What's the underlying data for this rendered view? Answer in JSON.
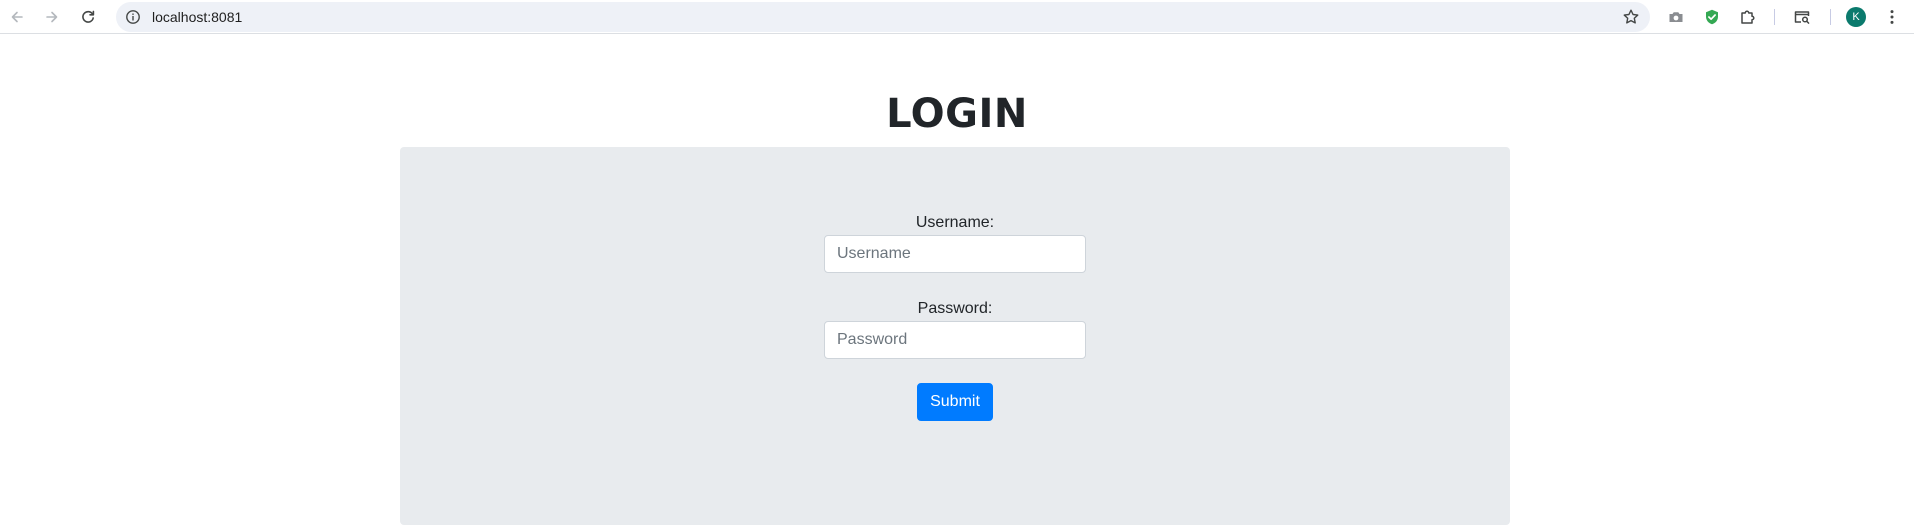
{
  "browser": {
    "url": "localhost:8081",
    "profile_initial": "K",
    "icons": {
      "back": "arrow-left-icon",
      "forward": "arrow-right-icon",
      "reload": "reload-icon",
      "site_info": "info-icon",
      "bookmark": "star-icon",
      "screenshot": "camera-icon",
      "extension_shield": "shield-check-icon",
      "extensions": "puzzle-icon",
      "tab_search": "tab-search-icon",
      "menu": "kebab-menu-icon"
    },
    "colors": {
      "omnibox": "#eef1f7",
      "avatar": "#0b7a6d",
      "shield": "#34a853"
    }
  },
  "page": {
    "title": "LOGIN",
    "form": {
      "username_label": "Username:",
      "username_placeholder": "Username",
      "username_value": "",
      "password_label": "Password:",
      "password_placeholder": "Password",
      "password_value": "",
      "submit_label": "Submit"
    },
    "colors": {
      "panel_background": "#e8ebee",
      "submit_button": "#007bff",
      "title_text": "#212529"
    }
  }
}
